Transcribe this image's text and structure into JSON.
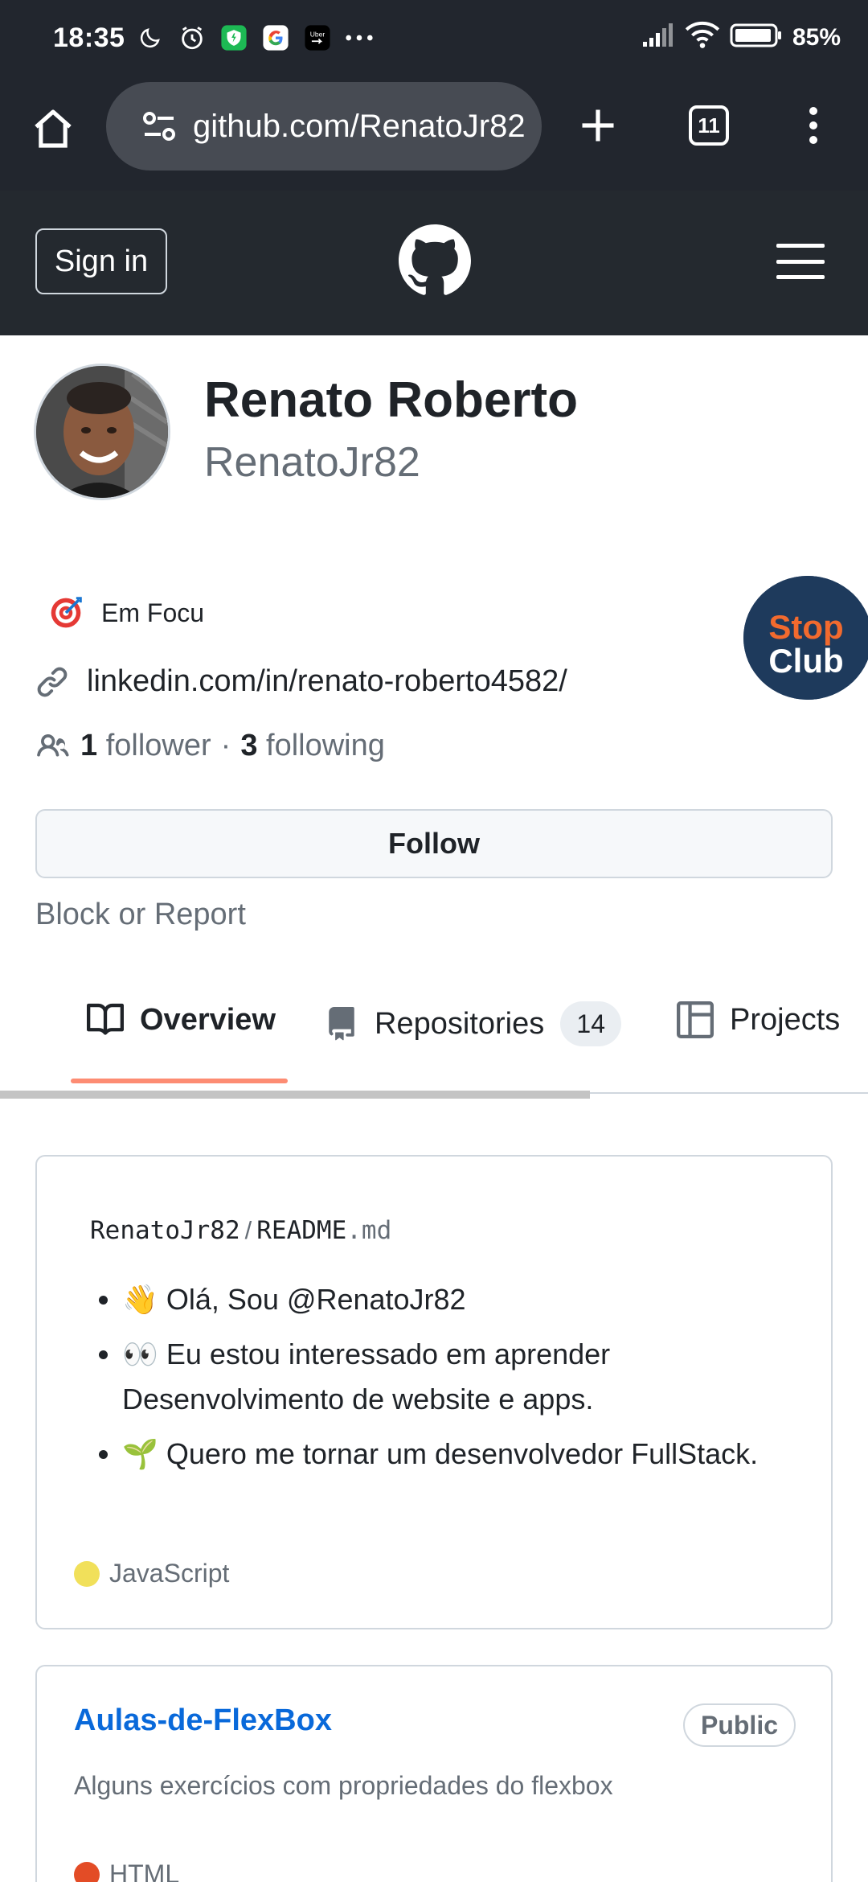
{
  "status_bar": {
    "time": "18:35",
    "battery": "85%",
    "icons": [
      "moon-icon",
      "alarm-icon",
      "shield-app-icon",
      "google-icon",
      "uber-icon",
      "more-dots-icon",
      "signal-icon",
      "wifi-icon",
      "battery-icon"
    ]
  },
  "browser": {
    "url": "github.com/RenatoJr82",
    "tab_count": "11"
  },
  "header": {
    "sign_in_label": "Sign in"
  },
  "profile": {
    "full_name": "Renato Roberto",
    "username": "RenatoJr82",
    "status_text": "Em Focu",
    "link": "linkedin.com/in/renato-roberto4582/",
    "followers_count": "1",
    "followers_label": "follower",
    "separator": "·",
    "following_count": "3",
    "following_label": "following",
    "follow_button": "Follow",
    "block_label": "Block or Report",
    "achievement_badge": "Stop Club"
  },
  "tabs": [
    {
      "label": "Overview",
      "active": true
    },
    {
      "label": "Repositories",
      "count": "14"
    },
    {
      "label": "Projects"
    }
  ],
  "readme": {
    "owner": "RenatoJr82",
    "sep": "/",
    "file_base": "README",
    "file_ext": ".md",
    "items": [
      "👋 Olá, Sou @RenatoJr82",
      "👀 Eu estou interessado em aprender Desenvolvimento de website e apps.",
      "🌱 Quero me tornar um desenvolvedor FullStack."
    ],
    "language": "JavaScript",
    "language_color": "#f1e05a"
  },
  "repo": {
    "name": "Aulas-de-FlexBox",
    "visibility": "Public",
    "description": "Alguns exercícios com propriedades do flexbox",
    "language": "HTML",
    "language_color": "#e34c26"
  },
  "colors": {
    "header_bg": "#24292f",
    "browser_bg": "#22262e",
    "link_blue": "#0969da",
    "tab_underline": "#fd8c73"
  }
}
